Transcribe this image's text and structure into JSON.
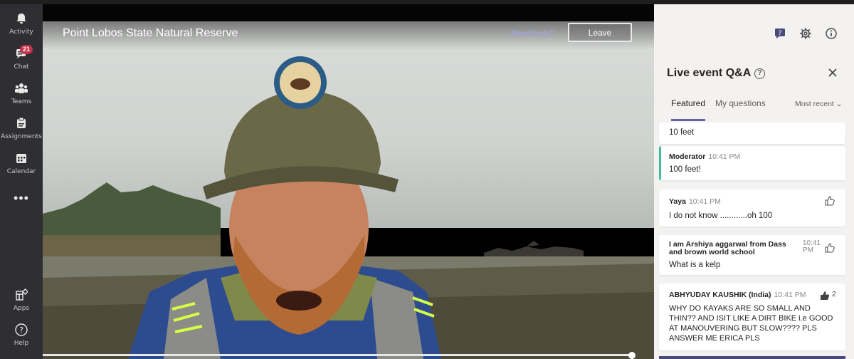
{
  "rail": {
    "items": [
      {
        "label": "Activity",
        "icon": "bell-icon"
      },
      {
        "label": "Chat",
        "icon": "chat-icon",
        "badge": "21"
      },
      {
        "label": "Teams",
        "icon": "teams-icon"
      },
      {
        "label": "Assignments",
        "icon": "assignments-icon"
      },
      {
        "label": "Calendar",
        "icon": "calendar-icon"
      }
    ],
    "more": "•••",
    "bottom_items": [
      {
        "label": "Apps",
        "icon": "apps-icon"
      },
      {
        "label": "Help",
        "icon": "help-icon"
      }
    ]
  },
  "video": {
    "title": "Point Lobos State Natural Reserve",
    "need_help": "Need help?",
    "leave_label": "Leave",
    "progress": 0.98
  },
  "panel": {
    "title": "Live event Q&A",
    "help_glyph": "?",
    "tabs": [
      {
        "label": "Featured",
        "active": true
      },
      {
        "label": "My questions",
        "active": false
      }
    ],
    "sort_label": "Most recent",
    "sort_chevron": "⌄",
    "feed": [
      {
        "message": "10 feet"
      },
      {
        "author": "Moderator",
        "time": "10:41 PM",
        "message": "100 feet!"
      },
      {
        "author": "Yaya",
        "time": "10:41 PM",
        "message": "I do not know ............oh 100"
      },
      {
        "author": "I am Arshiya aggarwal from Dass and brown world school",
        "time": "10:41 PM",
        "message": "What is a kelp"
      },
      {
        "author": "ABHYUDAY KAUSHIK (India)",
        "time": "10:41 PM",
        "likes": "2",
        "message": "WHY DO KAYAKS ARE SO SMALL AND THIN?? AND ISIT LIKE A DIRT BIKE i.e GOOD AT MANOUVERING BUT SLOW???? PLS ANSWER ME ERICA PLS"
      }
    ]
  },
  "colors": {
    "rail": "#2f2f33",
    "accent": "#6264a7",
    "badge": "#c4314b",
    "moderator_accent": "#3fbfa0"
  }
}
